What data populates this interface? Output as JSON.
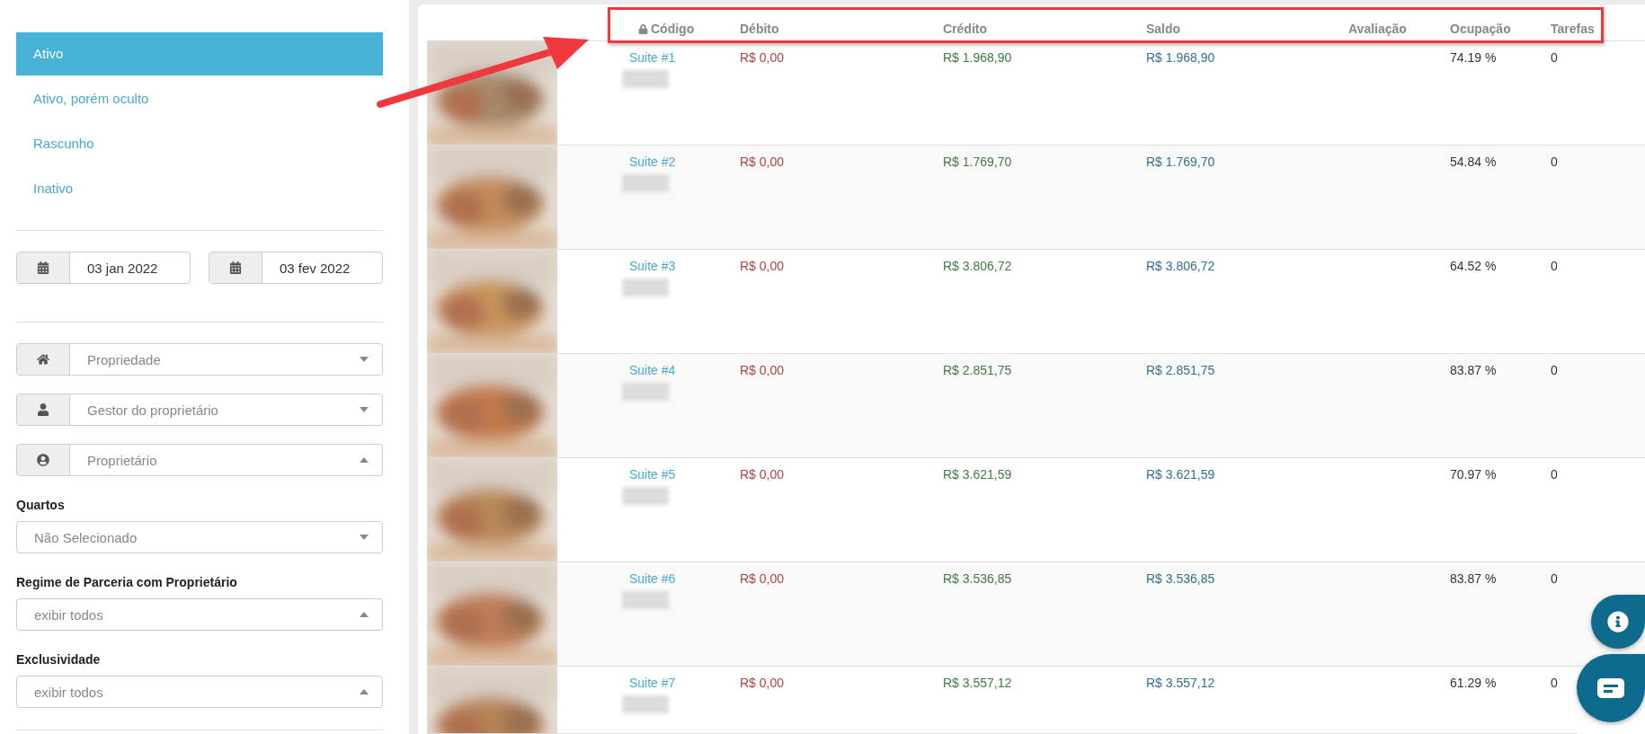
{
  "sidebar": {
    "statuses": [
      {
        "label": "Ativo",
        "selected": true
      },
      {
        "label": "Ativo, porém oculto",
        "selected": false
      },
      {
        "label": "Rascunho",
        "selected": false
      },
      {
        "label": "Inativo",
        "selected": false
      }
    ],
    "date_range": [
      {
        "value": "03 jan 2022"
      },
      {
        "value": "03 fev 2022"
      }
    ],
    "selects": [
      {
        "kind": "home",
        "placeholder": "Propriedade",
        "expanded": false
      },
      {
        "kind": "user",
        "placeholder": "Gestor do proprietário",
        "expanded": false
      },
      {
        "kind": "user-circle",
        "placeholder": "Proprietário",
        "expanded": true
      }
    ],
    "filters": [
      {
        "label": "Quartos",
        "placeholder": "Não Selecionado",
        "expanded": false
      },
      {
        "label": "Regime de Parceria com Proprietário",
        "placeholder": "exibir todos",
        "expanded": true
      },
      {
        "label": "Exclusividade",
        "placeholder": "exibir todos",
        "expanded": true
      }
    ]
  },
  "table": {
    "columns": [
      {
        "label": "Código",
        "locked": true
      },
      {
        "label": "Débito",
        "locked": false
      },
      {
        "label": "Crédito",
        "locked": false
      },
      {
        "label": "Saldo",
        "locked": false
      },
      {
        "label": "Avaliação",
        "locked": false
      },
      {
        "label": "Ocupação",
        "locked": false
      },
      {
        "label": "Tarefas",
        "locked": false
      }
    ],
    "rows": [
      {
        "code": "Suite #1",
        "debit": "R$ 0,00",
        "credit": "R$ 1.968,90",
        "balance": "R$ 1.968,90",
        "occupancy": "74.19 %",
        "tasks": "0"
      },
      {
        "code": "Suite #2",
        "debit": "R$ 0,00",
        "credit": "R$ 1.769,70",
        "balance": "R$ 1.769,70",
        "occupancy": "54.84 %",
        "tasks": "0"
      },
      {
        "code": "Suite #3",
        "debit": "R$ 0,00",
        "credit": "R$ 3.806,72",
        "balance": "R$ 3.806,72",
        "occupancy": "64.52 %",
        "tasks": "0"
      },
      {
        "code": "Suite #4",
        "debit": "R$ 0,00",
        "credit": "R$ 2.851,75",
        "balance": "R$ 2.851,75",
        "occupancy": "83.87 %",
        "tasks": "0"
      },
      {
        "code": "Suite #5",
        "debit": "R$ 0,00",
        "credit": "R$ 3.621,59",
        "balance": "R$ 3.621,59",
        "occupancy": "70.97 %",
        "tasks": "0"
      },
      {
        "code": "Suite #6",
        "debit": "R$ 0,00",
        "credit": "R$ 3.536,85",
        "balance": "R$ 3.536,85",
        "occupancy": "83.87 %",
        "tasks": "0"
      },
      {
        "code": "Suite #7",
        "debit": "R$ 0,00",
        "credit": "R$ 3.557,12",
        "balance": "R$ 3.557,12",
        "occupancy": "61.29 %",
        "tasks": "0"
      }
    ]
  }
}
